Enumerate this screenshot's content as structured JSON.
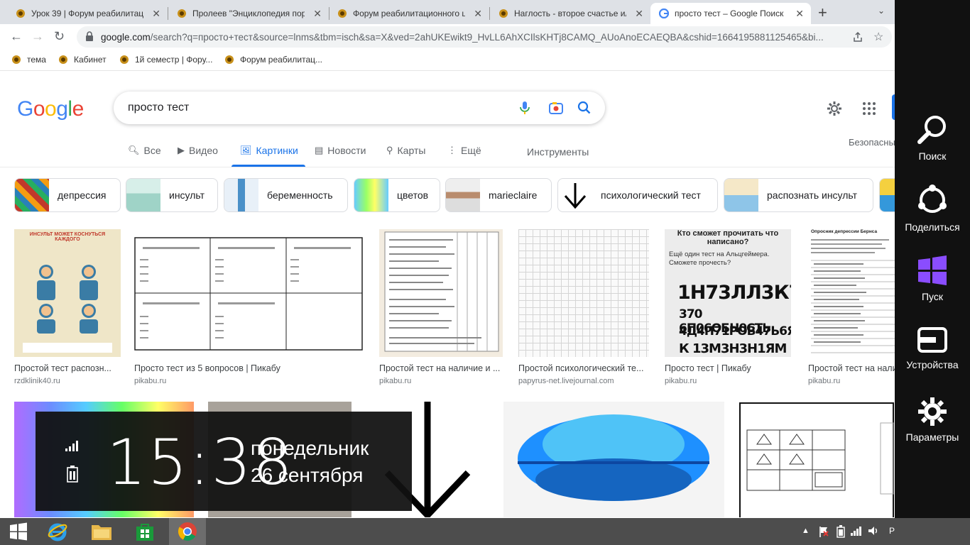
{
  "tabs": [
    {
      "title": "Урок 39 | Форум реабилитац"
    },
    {
      "title": "Пролеев \"Энциклопедия пор"
    },
    {
      "title": "Форум реабилитационного ц"
    },
    {
      "title": "Наглость - второе счастье ил"
    },
    {
      "title": "просто тест – Google Поиск"
    }
  ],
  "address": {
    "host": "google.com",
    "path": "/search?q=просто+тест&source=lnms&tbm=isch&sa=X&ved=2ahUKEwikt9_HvLL6AhXCIlsKHTj8CAMQ_AUoAnoECAEQBA&cshid=1664195881125465&bi..."
  },
  "bookmarks": [
    {
      "label": "тема"
    },
    {
      "label": "Кабинет"
    },
    {
      "label": "1й семестр | Фору..."
    },
    {
      "label": "Форум реабилитац..."
    }
  ],
  "search": {
    "query": "просто тест"
  },
  "nav": {
    "all": "Все",
    "video": "Видео",
    "images": "Картинки",
    "news": "Новости",
    "maps": "Карты",
    "more": "Ещё",
    "tools": "Инструменты",
    "safe": "Безопасны"
  },
  "chips": [
    {
      "label": "депрессия"
    },
    {
      "label": "инсульт"
    },
    {
      "label": "беременность"
    },
    {
      "label": "цветов"
    },
    {
      "label": "marieclaire"
    },
    {
      "label": "психологический тест"
    },
    {
      "label": "распознать инсульт"
    }
  ],
  "results": [
    {
      "caption": "Простой тест распозн...",
      "source": "rzdklinik40.ru",
      "img_text": "ИНСУЛЬТ МОЖЕТ КОСНУТЬСЯ КАЖДОГО"
    },
    {
      "caption": "Просто тест из 5 вопросов | Пикабу",
      "source": "pikabu.ru"
    },
    {
      "caption": "Простой тест на наличие и ...",
      "source": "pikabu.ru"
    },
    {
      "caption": "Простой психологический те...",
      "source": "papyrus-net.livejournal.com"
    },
    {
      "caption": "Просто тест | Пикабу",
      "source": "pikabu.ru",
      "img_title": "Кто сможет прочитать что написано?",
      "img_sub": "Ещё один тест на Альцгеймера. Сможете прочесть?",
      "img_lines": [
        "1Н73ЛЛ3К7",
        "370 6П06ОБН0СТЬ",
        "4Д4П71РОВ47Ь6Я",
        "К 13М3Н3Н1ЯМ"
      ]
    },
    {
      "caption": "Простой тест на нали",
      "source": "pikabu.ru",
      "img_text": "Опросник депрессии Бернса"
    }
  ],
  "charms": {
    "search": "Поиск",
    "share": "Поделиться",
    "start": "Пуск",
    "devices": "Устройства",
    "settings": "Параметры"
  },
  "clock": {
    "time": "15:38",
    "weekday": "понедельник",
    "date": "26 сентября"
  },
  "tray": {
    "lang": "Р"
  },
  "colors": {
    "accent": "#1a73e8",
    "charms_bg": "#111111",
    "taskbar_bg": "#4d4d4d"
  }
}
